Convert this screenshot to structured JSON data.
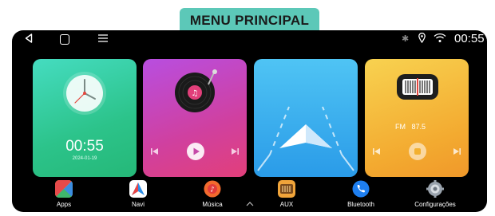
{
  "banner": {
    "title": "MENU PRINCIPAL"
  },
  "status": {
    "time": "00:55",
    "icons": [
      "bluetooth-icon",
      "location-icon",
      "wifi-icon"
    ]
  },
  "nav": {
    "icons": [
      "back-icon",
      "home-icon",
      "menu-icon"
    ]
  },
  "cards": {
    "clock": {
      "time": "00:55",
      "date": "2024-01-19"
    },
    "music": {
      "icon": "vinyl-record-icon"
    },
    "navi": {
      "icon": "navigation-arrow-icon"
    },
    "radio": {
      "band": "FM",
      "frequency": "87.5"
    }
  },
  "dock": {
    "items": [
      {
        "label": "Apps",
        "icon": "apps-icon"
      },
      {
        "label": "Navi",
        "icon": "navi-icon"
      },
      {
        "label": "Música",
        "icon": "music-icon"
      },
      {
        "label": "AUX",
        "icon": "aux-icon"
      },
      {
        "label": "Bluetooth",
        "icon": "bluetooth-phone-icon"
      },
      {
        "label": "Configurações",
        "icon": "settings-icon"
      }
    ]
  },
  "colors": {
    "banner": "#5cc8b8",
    "clock_card": "#2cc38a",
    "music_card": "#d0409f",
    "navi_card": "#2a9be8",
    "radio_card": "#f3aa30",
    "screen_bg": "#000000"
  }
}
